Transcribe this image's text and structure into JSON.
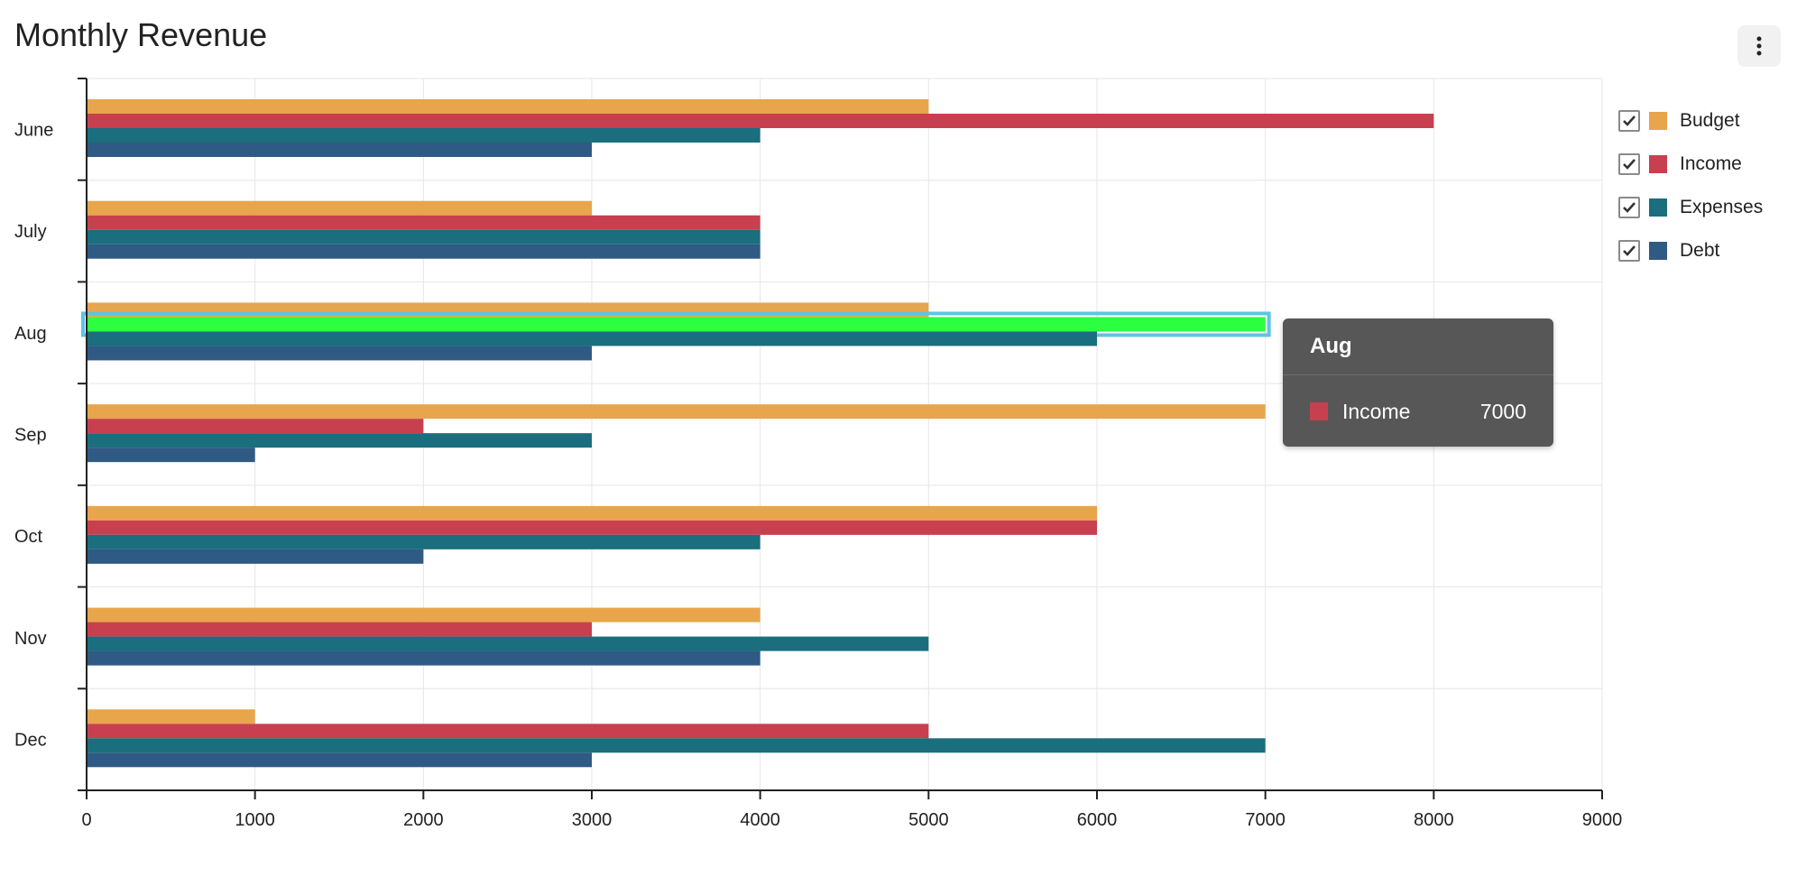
{
  "header": {
    "title": "Monthly Revenue",
    "menu_icon": "vertical-ellipsis-icon"
  },
  "colors": {
    "budget": "#e8a54b",
    "income": "#c8404f",
    "expenses": "#1a6e7e",
    "debt": "#2f5a84",
    "highlight": "#2bff3f",
    "highlight_border": "#5fc3e4",
    "grid": "#e6e6e6",
    "axis": "#222222"
  },
  "legend": {
    "items": [
      {
        "label": "Budget",
        "checked": true
      },
      {
        "label": "Income",
        "checked": true
      },
      {
        "label": "Expenses",
        "checked": true
      },
      {
        "label": "Debt",
        "checked": true
      }
    ]
  },
  "tooltip": {
    "title": "Aug",
    "series": "Income",
    "value": "7000"
  },
  "chart_data": {
    "type": "bar",
    "orientation": "horizontal",
    "title": "Monthly Revenue",
    "categories": [
      "June",
      "July",
      "Aug",
      "Sep",
      "Oct",
      "Nov",
      "Dec"
    ],
    "series": [
      {
        "name": "Budget",
        "values": [
          5000,
          3000,
          5000,
          7000,
          6000,
          4000,
          1000
        ]
      },
      {
        "name": "Income",
        "values": [
          8000,
          4000,
          7000,
          2000,
          6000,
          3000,
          5000
        ]
      },
      {
        "name": "Expenses",
        "values": [
          4000,
          4000,
          6000,
          3000,
          4000,
          5000,
          7000
        ]
      },
      {
        "name": "Debt",
        "values": [
          3000,
          4000,
          3000,
          1000,
          2000,
          4000,
          3000
        ]
      }
    ],
    "xlim": [
      0,
      9000
    ],
    "xticks": [
      0,
      1000,
      2000,
      3000,
      4000,
      5000,
      6000,
      7000,
      8000,
      9000
    ],
    "grid": true,
    "legend_position": "right",
    "highlighted": {
      "category": "Aug",
      "series": "Income"
    }
  }
}
